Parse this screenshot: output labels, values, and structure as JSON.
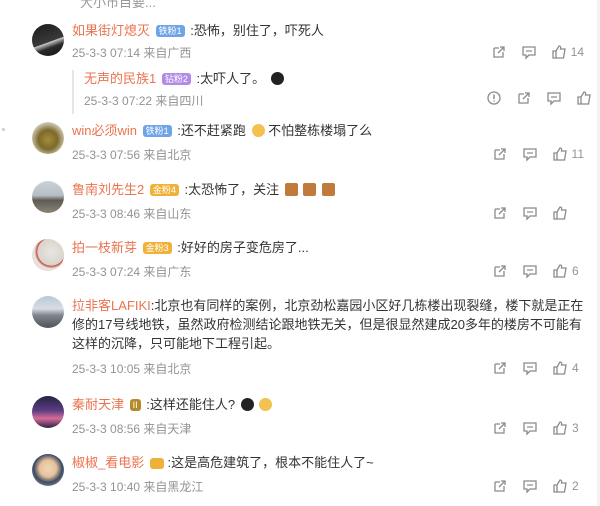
{
  "top_fragment": "大小市目要...",
  "comments": [
    {
      "name": "如果街灯熄灭",
      "badge": "铁粉1",
      "text": ":恐怖，别住了，吓死人",
      "meta": "25-3-3 07:14 来自广西",
      "likes": "14",
      "reply": {
        "name": "无声的民族1",
        "badge": "钻粉2",
        "text": ":太吓人了。",
        "meta": "25-3-3 07:22 来自四川"
      }
    },
    {
      "name": "win必须win",
      "badge": "铁粉1",
      "text": ":还不赶紧跑",
      "text2": "不怕整栋楼塌了么",
      "meta": "25-3-3 07:56 来自北京",
      "likes": "11"
    },
    {
      "name": "鲁南刘先生2",
      "badge": "金粉4",
      "text": ":太恐怖了，关注",
      "meta": "25-3-3 08:46 来自山东",
      "likes": ""
    },
    {
      "name": "拍一枝新芽",
      "badge": "金粉3",
      "text": ":好好的房子变危房了...",
      "meta": "25-3-3 07:24 来自广东",
      "likes": "6"
    },
    {
      "name": "拉非客LAFIKI",
      "text": ":北京也有同样的案例，北京劲松嘉园小区好几栋楼出现裂缝，楼下就是正在修的17号线地铁，虽然政府检测结论跟地铁无关，但是很显然建成20多年的楼房不可能有这样的沉降，只可能地下工程引起。",
      "meta": "25-3-3 10:05 来自北京",
      "likes": "4"
    },
    {
      "name": "秦耐天津",
      "badge": "II",
      "text": ":这样还能住人?",
      "meta": "25-3-3 08:56 来自天津",
      "likes": "3"
    },
    {
      "name": "椒椒_看电影",
      "text": ":这是高危建筑了，根本不能住人了~",
      "meta": "25-3-3 10:40 来自黑龙江",
      "likes": "2"
    }
  ]
}
